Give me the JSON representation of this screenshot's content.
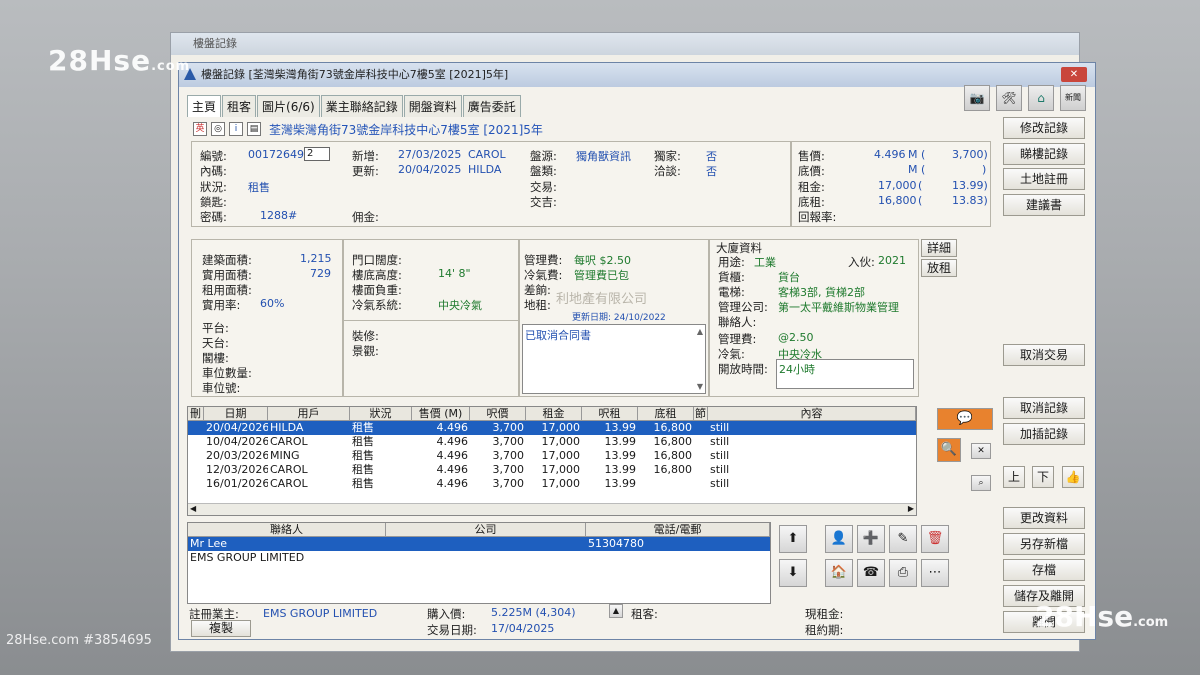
{
  "watermarks": {
    "top_left": "28Hse",
    "top_left_domain": ".com",
    "bottom_right": "28Hse",
    "bottom_right_domain": ".com",
    "bottom_left": "28Hse.com #3854695",
    "middle": "28Hse.com"
  },
  "back_window": {
    "title": "樓盤記錄"
  },
  "window": {
    "title": "樓盤記錄 [荃灣柴灣角街73號金岸科技中心7樓5室 [2021]5年]",
    "close": "✕"
  },
  "tabs": [
    "主頁",
    "租客",
    "圖片(6/6)",
    "業主聯絡記錄",
    "開盤資料",
    "廣告委託"
  ],
  "address_line": "荃灣柴灣角街73號金岸科技中心7樓5室 [2021]5年",
  "top_icons": [
    "camera-icon",
    "tools-icon",
    "home-icon",
    "news-icon"
  ],
  "top_icon_text": {
    "news": "新聞"
  },
  "basic": {
    "code_label": "編號:",
    "code": "00172649",
    "code_sel": "2",
    "inner_code_label": "內碼:",
    "status_label": "狀況:",
    "status": "租售",
    "key_label": "鎖匙:",
    "password_label": "密碼:",
    "password": "1288#",
    "new_label": "新增:",
    "new_date": "27/03/2025",
    "new_user": "CAROL",
    "update_label": "更新:",
    "update_date": "20/04/2025",
    "update_user": "HILDA",
    "commission_label": "佣金:",
    "source_label": "盤源:",
    "source": "獨角獸資訊",
    "exclusive_label": "獨家:",
    "exclusive": "否",
    "type_label": "盤類:",
    "negotiate_label": "洽談:",
    "negotiate": "否",
    "trade_label": "交易:",
    "deal_label": "交吉:"
  },
  "prices": {
    "sale_label": "售價:",
    "sale": "4.496",
    "sale_unit": "M (",
    "sale_psf": "3,700)",
    "floor_label": "底價:",
    "floor_unit": "M (",
    "floor_close": ")",
    "rent_label": "租金:",
    "rent": "17,000",
    "rent_open": "(",
    "rent_psf": "13.99)",
    "floor_rent_label": "底租:",
    "floor_rent": "16,800",
    "floor_rent_open": "(",
    "floor_rent_psf": "13.83)",
    "return_label": "回報率:"
  },
  "area": {
    "gross_label": "建築面積:",
    "gross": "1,215",
    "saleable_label": "實用面積:",
    "saleable": "729",
    "rent_area_label": "租用面積:",
    "efficiency_label": "實用率:",
    "efficiency": "60%",
    "platform_label": "平台:",
    "roof_label": "天台:",
    "loft_label": "閣樓:",
    "parking_count_label": "車位數量:",
    "parking_no_label": "車位號:"
  },
  "door": {
    "door_width_label": "門口闊度:",
    "ceiling_label": "樓底高度:",
    "ceiling": "14' 8\"",
    "load_label": "樓面負重:",
    "ac_label": "冷氣系統:",
    "ac": "中央冷氣",
    "decor_label": "裝修:",
    "view_label": "景觀:"
  },
  "fees": {
    "mgmt_label": "管理費:",
    "mgmt": "每呎 $2.50",
    "ac_fee_label": "冷氣費:",
    "ac_fee": "管理費已包",
    "rate_label": "差餉:",
    "ground_label": "地租:",
    "company_watermark": "利地產有限公司",
    "updated": "更新日期: 24/10/2022",
    "remark": "已取消合同書"
  },
  "building": {
    "header": "大廈資料",
    "usage_label": "用途:",
    "usage": "工業",
    "intake_label": "入伙:",
    "intake": "2021",
    "cargo_lift_label": "貨櫃:",
    "cargo_lift": "貨台",
    "lift_label": "電梯:",
    "lift": "客梯3部, 貨梯2部",
    "mgmt_co_label": "管理公司:",
    "mgmt_co": "第一太平戴維斯物業管理",
    "contact_label": "聯絡人:",
    "mgmt_fee_label": "管理費:",
    "mgmt_fee": "@2.50",
    "ac_label": "冷氣:",
    "ac": "中央冷水",
    "hours_label": "開放時間:",
    "hours": "24小時",
    "detail_btn": "詳細",
    "lease_btn": "放租"
  },
  "history": {
    "headers": [
      "刪",
      "日期",
      "用戶",
      "狀況",
      "售價 (M)",
      "呎價",
      "租金",
      "呎租",
      "底租",
      "節",
      "內容"
    ],
    "rows": [
      [
        "",
        "20/04/2026",
        "HILDA",
        "租售",
        "4.496",
        "3,700",
        "17,000",
        "13.99",
        "16,800",
        "",
        "still"
      ],
      [
        "",
        "10/04/2026",
        "CAROL",
        "租售",
        "4.496",
        "3,700",
        "17,000",
        "13.99",
        "16,800",
        "",
        "still"
      ],
      [
        "",
        "20/03/2026",
        "MING",
        "租售",
        "4.496",
        "3,700",
        "17,000",
        "13.99",
        "16,800",
        "",
        "still"
      ],
      [
        "",
        "12/03/2026",
        "CAROL",
        "租售",
        "4.496",
        "3,700",
        "17,000",
        "13.99",
        "16,800",
        "",
        "still"
      ],
      [
        "",
        "16/01/2026",
        "CAROL",
        "租售",
        "4.496",
        "3,700",
        "17,000",
        "13.99",
        "",
        "",
        "still"
      ]
    ]
  },
  "contacts": {
    "headers": [
      "聯絡人",
      "公司",
      "電話/電郵"
    ],
    "rows": [
      [
        "Mr Lee",
        "",
        "51304780"
      ],
      [
        "EMS GROUP LIMITED",
        "",
        ""
      ]
    ]
  },
  "footer": {
    "owner_label": "註冊業主:",
    "owner": "EMS GROUP LIMITED",
    "copy_btn": "複製",
    "buy_price_label": "購入價:",
    "buy_price": "5.225M (4,304)",
    "trade_date_label": "交易日期:",
    "trade_date": "17/04/2025",
    "tenant_label": "租客:",
    "current_rent_label": "現租金:",
    "lease_term_label": "租約期:"
  },
  "side_buttons": {
    "modify": "修改記錄",
    "view": "睇樓記錄",
    "land": "土地註冊",
    "suggest": "建議書",
    "cancel_deal": "取消交易",
    "cancel_record": "取消記錄",
    "add_record": "加插記錄",
    "up": "上",
    "down": "下",
    "change": "更改資料",
    "save_new": "另存新檔",
    "save": "存檔",
    "save_exit": "儲存及離開",
    "leave": "離開"
  }
}
